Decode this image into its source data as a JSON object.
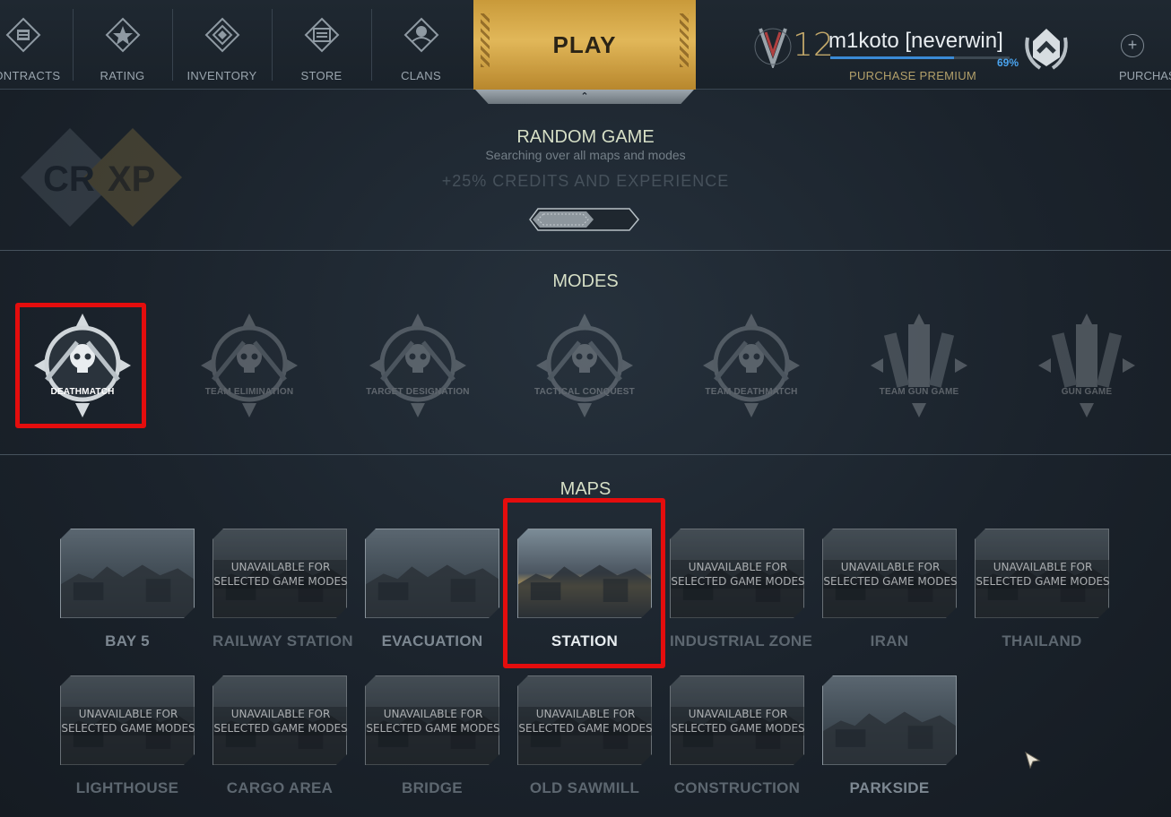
{
  "nav": {
    "items": [
      {
        "label": "CONTRACTS",
        "icon": "contracts-icon"
      },
      {
        "label": "RATING",
        "icon": "rating-icon"
      },
      {
        "label": "INVENTORY",
        "icon": "inventory-icon"
      },
      {
        "label": "STORE",
        "icon": "store-icon"
      },
      {
        "label": "CLANS",
        "icon": "clans-icon"
      }
    ],
    "play_label": "PLAY",
    "right_purchase_label": "PURCHAS"
  },
  "profile": {
    "level": "12",
    "username": "m1koto [neverwin]",
    "xp_percent_text": "69%",
    "xp_fraction": 0.69,
    "purchase_premium": "PURCHASE PREMIUM"
  },
  "random_game": {
    "logo_text_cr": "CR",
    "logo_text_xp": "XP",
    "title": "RANDOM GAME",
    "subtitle": "Searching over all maps and modes",
    "bonus": "+25% CREDITS AND EXPERIENCE"
  },
  "modes": {
    "title": "MODES",
    "items": [
      {
        "label": "DEATHMATCH",
        "selected": true
      },
      {
        "label": "TEAM ELIMINATION",
        "selected": false
      },
      {
        "label": "TARGET DESIGNATION",
        "selected": false
      },
      {
        "label": "TACTICAL CONQUEST",
        "selected": false
      },
      {
        "label": "TEAM DEATHMATCH",
        "selected": false
      },
      {
        "label": "TEAM GUN GAME",
        "selected": false
      },
      {
        "label": "GUN GAME",
        "selected": false
      }
    ]
  },
  "maps": {
    "title": "MAPS",
    "unavailable_line1": "UNAVAILABLE FOR",
    "unavailable_line2": "SELECTED GAME MODES",
    "row1": [
      {
        "label": "BAY 5",
        "available": true,
        "selected": false
      },
      {
        "label": "RAILWAY STATION",
        "available": false,
        "selected": false
      },
      {
        "label": "EVACUATION",
        "available": true,
        "selected": false
      },
      {
        "label": "STATION",
        "available": true,
        "selected": true
      },
      {
        "label": "INDUSTRIAL ZONE",
        "available": false,
        "selected": false
      },
      {
        "label": "IRAN",
        "available": false,
        "selected": false
      },
      {
        "label": "THAILAND",
        "available": false,
        "selected": false
      }
    ],
    "row2": [
      {
        "label": "LIGHTHOUSE",
        "available": false,
        "selected": false
      },
      {
        "label": "CARGO AREA",
        "available": false,
        "selected": false
      },
      {
        "label": "BRIDGE",
        "available": false,
        "selected": false
      },
      {
        "label": "OLD SAWMILL",
        "available": false,
        "selected": false
      },
      {
        "label": "CONSTRUCTION",
        "available": false,
        "selected": false
      },
      {
        "label": "PARKSIDE",
        "available": true,
        "selected": false
      }
    ]
  },
  "colors": {
    "background": "#1b232c",
    "play_gold": "#e1b759",
    "highlight_red": "#e40d0d",
    "xp_blue": "#3a8ad6"
  }
}
